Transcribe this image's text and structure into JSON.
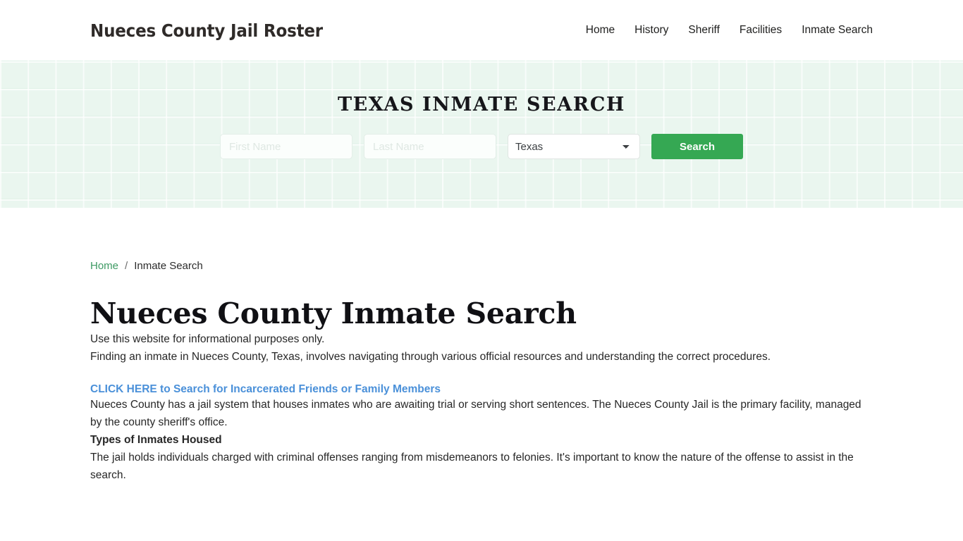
{
  "header": {
    "brand": "Nueces County Jail Roster",
    "nav": [
      {
        "label": "Home"
      },
      {
        "label": "History"
      },
      {
        "label": "Sheriff"
      },
      {
        "label": "Facilities"
      },
      {
        "label": "Inmate Search"
      }
    ]
  },
  "hero": {
    "title": "TEXAS INMATE SEARCH",
    "accent_color": "#35a853",
    "background_color": "#eaf6ef",
    "form": {
      "first_name_value": "",
      "first_name_placeholder": "First Name",
      "last_name_value": "",
      "last_name_placeholder": "Last Name",
      "state_selected": "Texas",
      "state_options": [
        "Texas"
      ],
      "search_label": "Search"
    }
  },
  "breadcrumb": {
    "home_label": "Home",
    "separator": "/",
    "current_label": "Inmate Search"
  },
  "main": {
    "page_title": "Nueces County Inmate Search",
    "intro": "Use this website for informational purposes only.",
    "finding": "Finding an inmate in Nueces County, Texas, involves navigating through various official resources and understanding the correct procedures.",
    "cta_link": "CLICK HERE to Search for Incarcerated Friends or Family Members",
    "cta_link_color": "#4a90d9",
    "jail_system": "Nueces County has a jail system that houses inmates who are awaiting trial or serving short sentences. The Nueces County Jail is the primary facility, managed by the county sheriff's office.",
    "subheading_types": "Types of Inmates Housed",
    "offenses": "The jail holds individuals charged with criminal offenses ranging from misdemeanors to felonies. It's important to know the nature of the offense to assist in the search."
  }
}
